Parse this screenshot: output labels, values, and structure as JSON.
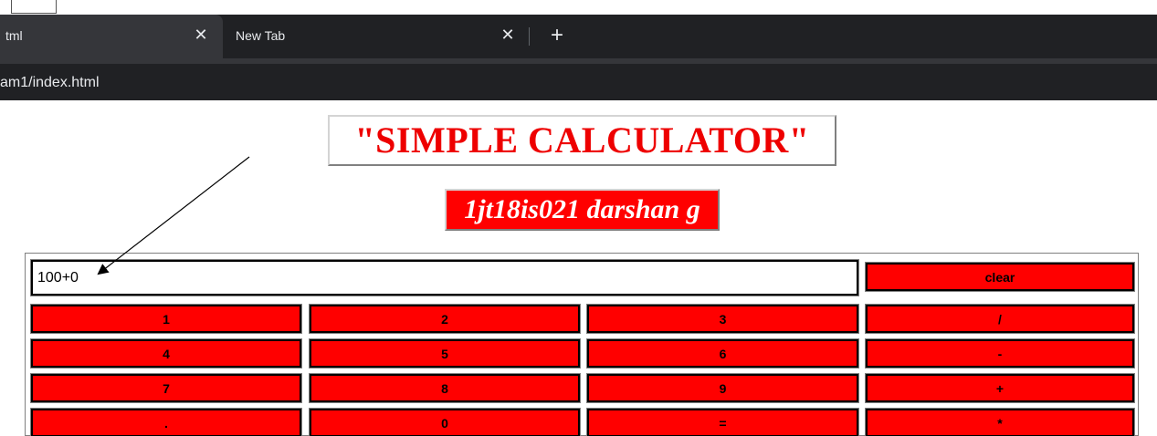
{
  "browser": {
    "tabs": [
      {
        "label": "tml",
        "active": true
      },
      {
        "label": "New Tab",
        "active": false
      }
    ],
    "close_glyph": "✕",
    "newtab_glyph": "+",
    "url": "am1/index.html"
  },
  "page": {
    "title": "\"SIMPLE CALCULATOR\"",
    "subtitle": "1jt18is021 darshan g",
    "colors": {
      "title": "#ee0000",
      "subtitle_bg": "#ff0000",
      "key_bg": "#ff0000"
    }
  },
  "calculator": {
    "display_value": "100+0",
    "clear_label": "clear",
    "rows": [
      [
        "1",
        "2",
        "3",
        "/"
      ],
      [
        "4",
        "5",
        "6",
        "-"
      ],
      [
        "7",
        "8",
        "9",
        "+"
      ],
      [
        ".",
        "0",
        "=",
        "*"
      ]
    ]
  }
}
